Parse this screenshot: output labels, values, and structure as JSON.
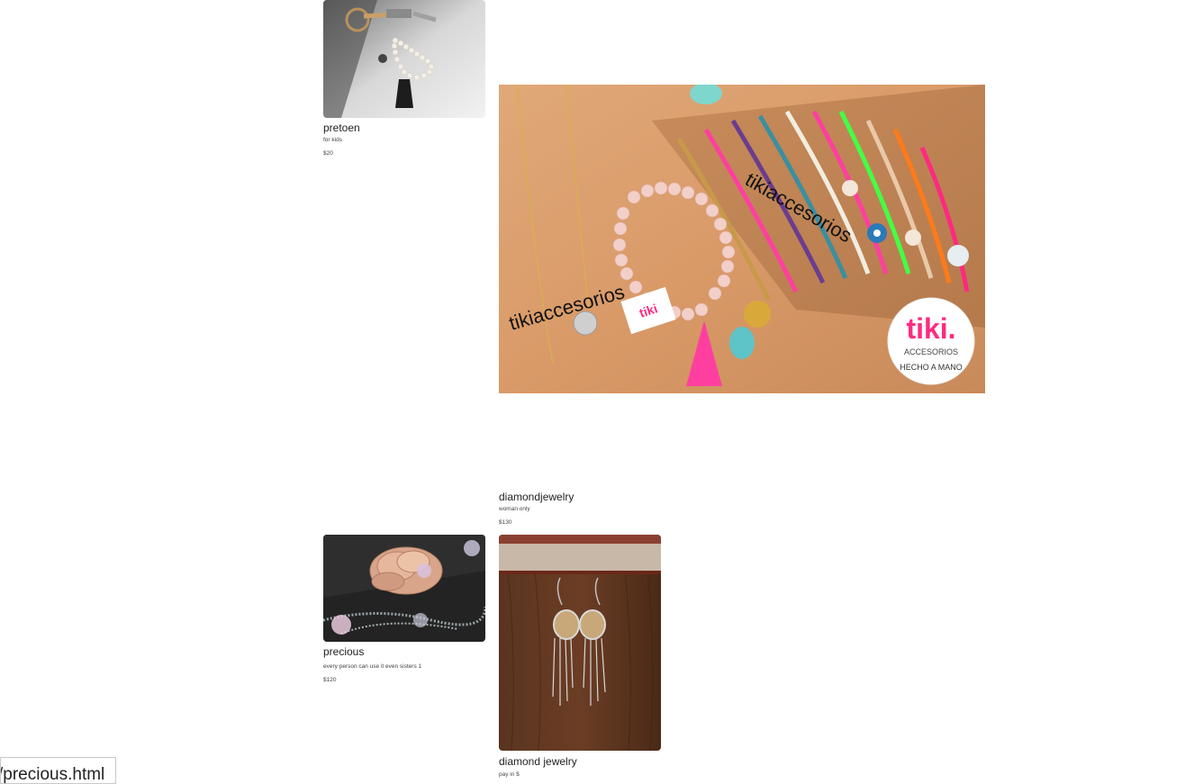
{
  "products": [
    {
      "title": "pretoen",
      "description": "for kids",
      "price": "$20"
    },
    {
      "title": "diamondjewelry",
      "description": "woman only",
      "price": "$130",
      "image_text": [
        "tikiaccesorios",
        "tikiaccesorios"
      ],
      "logo": {
        "brand": "tiki.",
        "line1": "ACCESORIOS",
        "line2": "HECHO A MANO"
      }
    },
    {
      "title": "precious",
      "description": "every person can use it even sisters 1",
      "price": "$120"
    },
    {
      "title": "diamond jewelry",
      "description": "pay in $"
    }
  ],
  "status_bar": {
    "url": "/precious.html"
  }
}
